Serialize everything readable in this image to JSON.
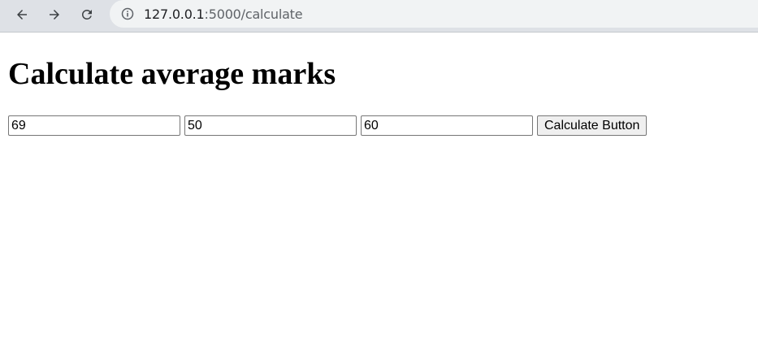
{
  "browser": {
    "url_host": "127.0.0.1",
    "url_rest": ":5000/calculate",
    "icons": {
      "back": "arrow-left-icon",
      "forward": "arrow-right-icon",
      "reload": "reload-icon",
      "info": "info-icon"
    }
  },
  "page": {
    "heading": "Calculate average marks",
    "inputs": [
      {
        "value": "69"
      },
      {
        "value": "50"
      },
      {
        "value": "60"
      }
    ],
    "button_label": "Calculate Button"
  }
}
